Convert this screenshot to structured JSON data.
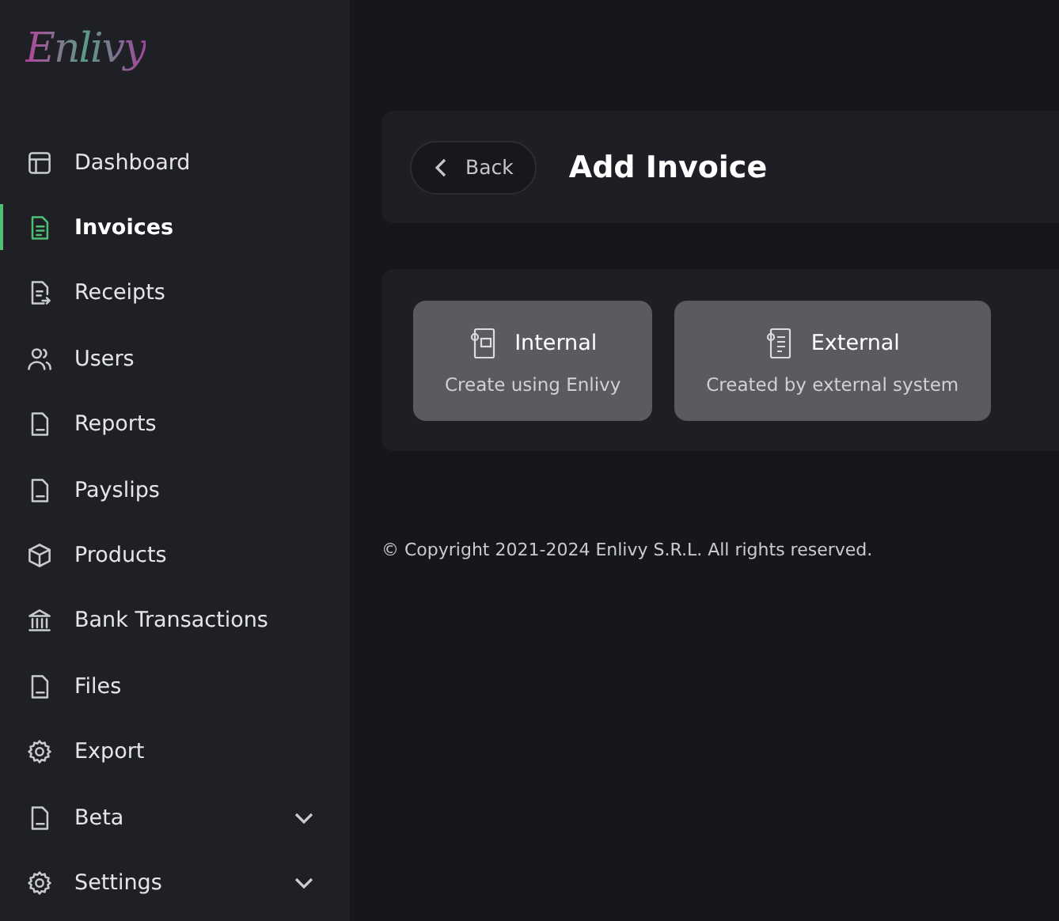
{
  "logo": "Enlivy",
  "sidebar": {
    "items": [
      {
        "label": "Dashboard",
        "kind": "link",
        "selected": false
      },
      {
        "label": "Invoices",
        "kind": "link",
        "selected": true
      },
      {
        "label": "Receipts",
        "kind": "link",
        "selected": false
      },
      {
        "label": "Users",
        "kind": "link",
        "selected": false
      },
      {
        "label": "Reports",
        "kind": "link",
        "selected": false
      },
      {
        "label": "Payslips",
        "kind": "link",
        "selected": false
      },
      {
        "label": "Products",
        "kind": "link",
        "selected": false
      },
      {
        "label": "Bank Transactions",
        "kind": "link",
        "selected": false
      },
      {
        "label": "Files",
        "kind": "link",
        "selected": false
      },
      {
        "label": "Export",
        "kind": "link",
        "selected": false
      },
      {
        "label": "Beta",
        "kind": "group",
        "selected": false,
        "expanded": false
      },
      {
        "label": "Settings",
        "kind": "group",
        "selected": false,
        "expanded": false
      }
    ]
  },
  "header": {
    "back": "Back",
    "title": "Add Invoice"
  },
  "options": [
    {
      "title": "Internal",
      "subtitle": "Create using Enlivy"
    },
    {
      "title": "External",
      "subtitle": "Created by external system"
    }
  ],
  "footer": "© Copyright 2021-2024 Enlivy S.R.L. All rights reserved."
}
